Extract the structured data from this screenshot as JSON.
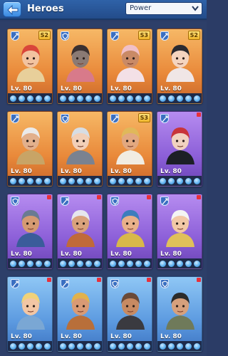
{
  "header": {
    "title": "Heroes",
    "sort_label": "Power"
  },
  "colors": {
    "orange_card": "#e9893a",
    "purple_card": "#8c5fd8",
    "blue_card": "#5c9ae0",
    "header_bg": "#2f62a8"
  },
  "heroes": [
    {
      "level": "Lv. 80",
      "rarity": "orange",
      "class_icon": "sword-icon",
      "skin": "S2",
      "stars_lit": 5,
      "hair": "#d9463a",
      "skin_tone": "#f2c3a0",
      "outfit": "#e8cf9a"
    },
    {
      "level": "Lv. 80",
      "rarity": "orange",
      "class_icon": "shield-icon",
      "skin": "",
      "stars_lit": 5,
      "hair": "#3a3030",
      "skin_tone": "#8a7a74",
      "outfit": "#d87a8a"
    },
    {
      "level": "Lv. 80",
      "rarity": "orange",
      "class_icon": "sword-icon",
      "skin": "S3",
      "stars_lit": 5,
      "hair": "#f0c0c8",
      "skin_tone": "#c98a66",
      "outfit": "#f3e0e6"
    },
    {
      "level": "Lv. 80",
      "rarity": "orange",
      "class_icon": "sword-icon",
      "skin": "S2",
      "stars_lit": 5,
      "hair": "#2a2a30",
      "skin_tone": "#f4d4bf",
      "outfit": "#f0e6e6"
    },
    {
      "level": "Lv. 80",
      "rarity": "orange",
      "class_icon": "sword-icon",
      "skin": "",
      "stars_lit": 5,
      "hair": "#eaeaea",
      "skin_tone": "#e2b08c",
      "outfit": "#c8a466"
    },
    {
      "level": "Lv. 80",
      "rarity": "orange",
      "class_icon": "shield-icon",
      "skin": "",
      "stars_lit": 5,
      "hair": "#d7dde4",
      "skin_tone": "#f2cfb7",
      "outfit": "#7a8290"
    },
    {
      "level": "Lv. 80",
      "rarity": "orange",
      "class_icon": "sword-icon",
      "skin": "S3",
      "stars_lit": 5,
      "hair": "#e0b85a",
      "skin_tone": "#e2a880",
      "outfit": "#f1ece2"
    },
    {
      "level": "Lv. 80",
      "rarity": "purple",
      "class_icon": "sword-icon",
      "skin": "",
      "stars_lit": 5,
      "hair": "#c8343a",
      "skin_tone": "#f1d2c0",
      "outfit": "#1c1f26"
    },
    {
      "level": "Lv. 80",
      "rarity": "purple",
      "class_icon": "shield-icon",
      "skin": "",
      "stars_lit": 5,
      "hair": "#6a7b92",
      "skin_tone": "#d59a72",
      "outfit": "#3a5c9a"
    },
    {
      "level": "Lv. 80",
      "rarity": "purple",
      "class_icon": "sword-icon",
      "skin": "",
      "stars_lit": 5,
      "hair": "#e6e6ee",
      "skin_tone": "#d9a27c",
      "outfit": "#c06a3a"
    },
    {
      "level": "Lv. 80",
      "rarity": "purple",
      "class_icon": "shield-icon",
      "skin": "",
      "stars_lit": 5,
      "hair": "#3c7dbd",
      "skin_tone": "#e8b08a",
      "outfit": "#d8b84a"
    },
    {
      "level": "Lv. 80",
      "rarity": "purple",
      "class_icon": "sword-icon",
      "skin": "",
      "stars_lit": 5,
      "hair": "#f4f4f4",
      "skin_tone": "#f2c8a6",
      "outfit": "#e0c05a"
    },
    {
      "level": "Lv. 80",
      "rarity": "blue",
      "class_icon": "sword-icon",
      "skin": "",
      "stars_lit": 5,
      "hair": "#f0d27a",
      "skin_tone": "#f2c6a4",
      "outfit": "#7aa7d4"
    },
    {
      "level": "Lv. 80",
      "rarity": "blue",
      "class_icon": "sword-icon",
      "skin": "",
      "stars_lit": 5,
      "hair": "#e1b24e",
      "skin_tone": "#d99a74",
      "outfit": "#b86f3a"
    },
    {
      "level": "Lv. 80",
      "rarity": "blue",
      "class_icon": "shield-icon",
      "skin": "",
      "stars_lit": 5,
      "hair": "#6a4a38",
      "skin_tone": "#c78a62",
      "outfit": "#3a3a40"
    },
    {
      "level": "Lv. 80",
      "rarity": "blue",
      "class_icon": "shield-icon",
      "skin": "",
      "stars_lit": 5,
      "hair": "#2b2b2b",
      "skin_tone": "#d6a07c",
      "outfit": "#6f7a5a"
    }
  ]
}
